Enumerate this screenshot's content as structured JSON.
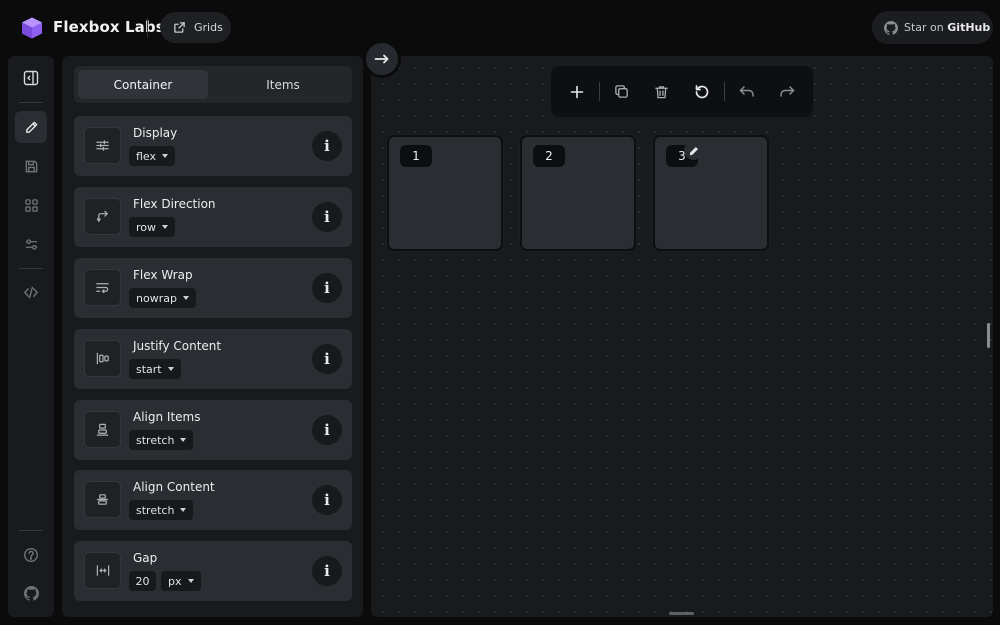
{
  "header": {
    "brand": "Flexbox Labs",
    "grids_label": "Grids",
    "star_prefix": "Star on ",
    "star_strong": "GitHub",
    "accent": "#9b6cf3"
  },
  "rail": {
    "items": [
      {
        "icon": "sidebar-toggle-icon"
      },
      {
        "icon": "pencil-icon",
        "active": true
      },
      {
        "icon": "save-icon"
      },
      {
        "icon": "grid-icon"
      },
      {
        "icon": "sliders-icon"
      },
      {
        "icon": "code-icon"
      },
      {
        "icon": "help-icon"
      },
      {
        "icon": "github-icon"
      }
    ]
  },
  "panel": {
    "tabs": [
      {
        "label": "Container",
        "active": true
      },
      {
        "label": "Items",
        "active": false
      }
    ],
    "properties": [
      {
        "label": "Display",
        "value": "flex",
        "icon": "display-icon"
      },
      {
        "label": "Flex Direction",
        "value": "row",
        "icon": "direction-icon"
      },
      {
        "label": "Flex Wrap",
        "value": "nowrap",
        "icon": "wrap-icon"
      },
      {
        "label": "Justify Content",
        "value": "start",
        "icon": "justify-icon"
      },
      {
        "label": "Align Items",
        "value": "stretch",
        "icon": "align-items-icon"
      },
      {
        "label": "Align Content",
        "value": "stretch",
        "icon": "align-content-icon"
      },
      {
        "label": "Gap",
        "value": "20",
        "unit": "px",
        "icon": "gap-icon"
      }
    ]
  },
  "canvas": {
    "toolbar": [
      "add-icon",
      "duplicate-icon",
      "trash-icon",
      "reset-icon",
      "undo-icon",
      "redo-icon"
    ],
    "items": [
      {
        "number": "1"
      },
      {
        "number": "2"
      },
      {
        "number": "3",
        "editing": true
      }
    ]
  }
}
